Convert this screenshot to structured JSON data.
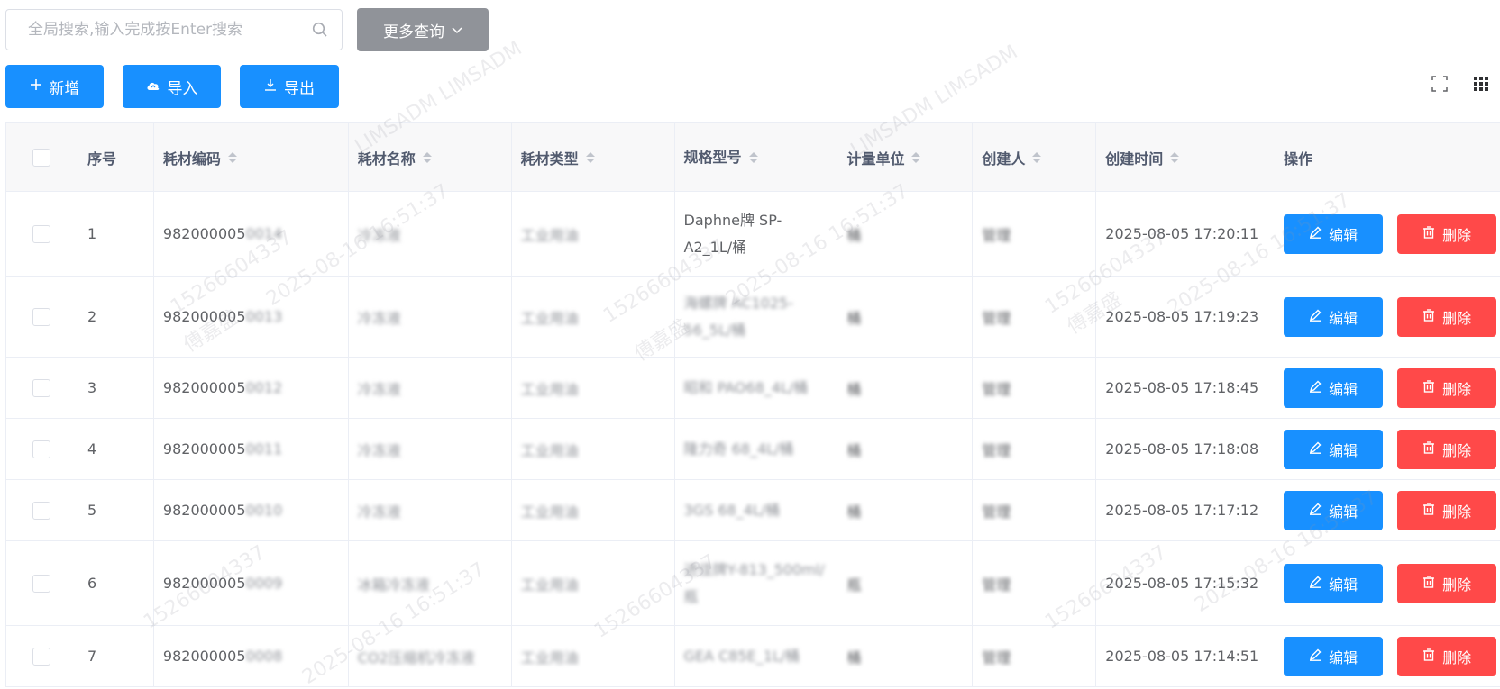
{
  "search": {
    "placeholder": "全局搜索,输入完成按Enter搜索",
    "more_label": "更多查询"
  },
  "toolbar": {
    "add_label": "新增",
    "import_label": "导入",
    "export_label": "导出"
  },
  "table": {
    "headers": {
      "seq": "序号",
      "code": "耗材编码",
      "name": "耗材名称",
      "type": "耗材类型",
      "spec": "规格型号",
      "unit": "计量单位",
      "creator": "创建人",
      "time": "创建时间",
      "op": "操作"
    },
    "rows": [
      {
        "seq": "1",
        "code": "982000005",
        "code_blur": "0014",
        "name": "冷冻液",
        "type": "工业用油",
        "spec": "Daphne牌 SP-A2_1L/桶",
        "unit": "桶",
        "creator": "管理",
        "time": "2025-08-05 17:20:11"
      },
      {
        "seq": "2",
        "code": "982000005",
        "code_blur": "0013",
        "name": "冷冻液",
        "type": "工业用油",
        "spec": "海螺牌 AC1025-56_5L/桶",
        "unit": "桶",
        "creator": "管理",
        "time": "2025-08-05 17:19:23"
      },
      {
        "seq": "3",
        "code": "982000005",
        "code_blur": "0012",
        "name": "冷冻液",
        "type": "工业用油",
        "spec": "昭和 PAO68_4L/桶",
        "unit": "桶",
        "creator": "管理",
        "time": "2025-08-05 17:18:45"
      },
      {
        "seq": "4",
        "code": "982000005",
        "code_blur": "0011",
        "name": "冷冻液",
        "type": "工业用油",
        "spec": "隆力奇 68_4L/桶",
        "unit": "桶",
        "creator": "管理",
        "time": "2025-08-05 17:18:08"
      },
      {
        "seq": "5",
        "code": "982000005",
        "code_blur": "0010",
        "name": "冷冻液",
        "type": "工业用油",
        "spec": "3GS 68_4L/桶",
        "unit": "桶",
        "creator": "管理",
        "time": "2025-08-05 17:17:12"
      },
      {
        "seq": "6",
        "code": "982000005",
        "code_blur": "0009",
        "name": "冰箱冷冻液",
        "type": "工业用油",
        "spec": "进佳牌Y-813_500ml/瓶",
        "unit": "瓶",
        "creator": "管理",
        "time": "2025-08-05 17:15:32"
      },
      {
        "seq": "7",
        "code": "982000005",
        "code_blur": "0008",
        "name": "CO2压缩机冷冻液",
        "type": "工业用油",
        "spec": "GEA C85E_1L/桶",
        "unit": "桶",
        "creator": "管理",
        "time": "2025-08-05 17:14:51"
      }
    ],
    "edit_label": "编辑",
    "delete_label": "删除"
  },
  "watermarks": [
    "LIMSADM LIMSADM",
    "15266604337",
    "傅嘉盛",
    "2025-08-16 16:51:37"
  ],
  "colors": {
    "primary": "#1890ff",
    "danger": "#ff4949",
    "info": "#909399"
  }
}
